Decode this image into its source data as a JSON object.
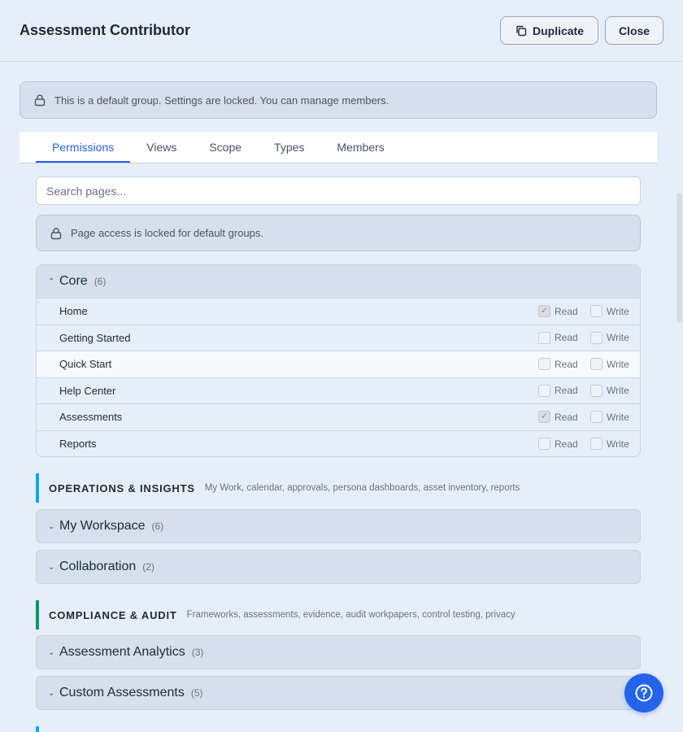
{
  "header": {
    "title": "Assessment Contributor",
    "duplicate_label": "Duplicate",
    "close_label": "Close"
  },
  "banner": {
    "text": "This is a default group. Settings are locked. You can manage members.",
    "icon": "lock-icon"
  },
  "tabs": [
    {
      "label": "Permissions",
      "active": true
    },
    {
      "label": "Views",
      "active": false
    },
    {
      "label": "Scope",
      "active": false
    },
    {
      "label": "Types",
      "active": false
    },
    {
      "label": "Members",
      "active": false
    }
  ],
  "search": {
    "placeholder": "Search pages...",
    "value": ""
  },
  "lock_notice": {
    "text": "Page access is locked for default groups.",
    "icon": "lock-icon"
  },
  "core": {
    "name": "Core",
    "count": "(6)",
    "expanded": true,
    "read_label": "Read",
    "write_label": "Write",
    "rows": [
      {
        "label": "Home",
        "read": true,
        "write": false
      },
      {
        "label": "Getting Started",
        "read": false,
        "write": false
      },
      {
        "label": "Quick Start",
        "read": false,
        "write": false
      },
      {
        "label": "Help Center",
        "read": false,
        "write": false
      },
      {
        "label": "Assessments",
        "read": true,
        "write": false
      },
      {
        "label": "Reports",
        "read": false,
        "write": false
      }
    ]
  },
  "sections": [
    {
      "title": "OPERATIONS & INSIGHTS",
      "description": "My Work, calendar, approvals, persona dashboards, asset inventory, reports",
      "color": "#0ea5e9",
      "groups": [
        {
          "name": "My Workspace",
          "count": "(6)"
        },
        {
          "name": "Collaboration",
          "count": "(2)"
        }
      ]
    },
    {
      "title": "COMPLIANCE & AUDIT",
      "description": "Frameworks, assessments, evidence, audit workpapers, control testing, privacy",
      "color": "#059669",
      "groups": [
        {
          "name": "Assessment Analytics",
          "count": "(3)"
        },
        {
          "name": "Custom Assessments",
          "count": "(5)"
        }
      ]
    }
  ],
  "colors": {
    "accent": "#2563eb",
    "background": "#e6eef9",
    "panel": "#d6e0ec"
  },
  "help_button": {
    "icon": "question-circle-icon"
  }
}
